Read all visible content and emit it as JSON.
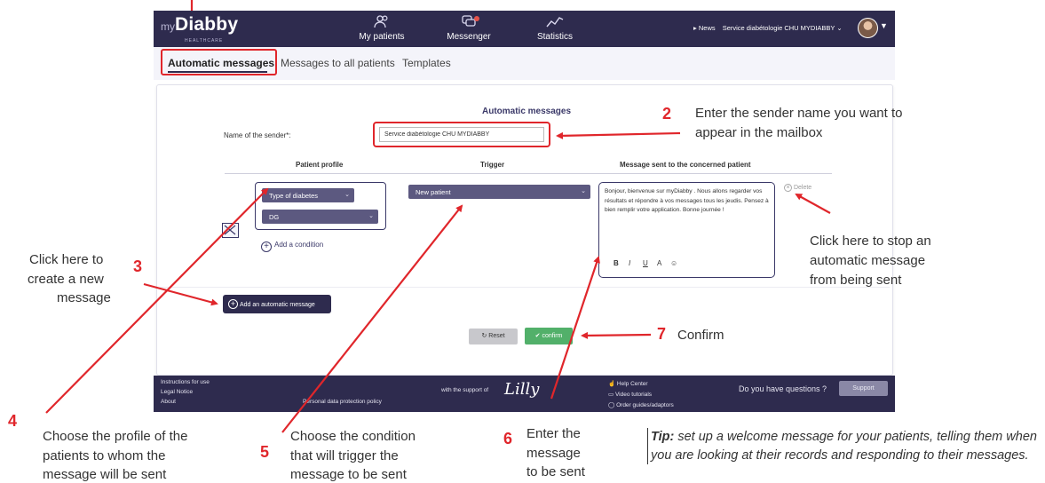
{
  "navbar": {
    "logo_prefix": "my",
    "logo_name": "Diabby",
    "logo_sub": "HEALTHCARE",
    "items": [
      {
        "label": "My patients",
        "icon": "people-icon"
      },
      {
        "label": "Messenger",
        "icon": "chat-icon"
      },
      {
        "label": "Statistics",
        "icon": "chart-icon"
      }
    ],
    "news_label": "News",
    "service_label": "Service diabétologie CHU MYDIABBY"
  },
  "tabs": [
    "Automatic messages",
    "Messages to all patients",
    "Templates"
  ],
  "form": {
    "title": "Automatic messages",
    "sender_label": "Name of the sender*:",
    "sender_value": "Service diabétologie CHU MYDIABBY",
    "columns": [
      "Patient profile",
      "Trigger",
      "Message sent to the concerned patient"
    ],
    "profile_select": "Type of diabetes",
    "profile_value": "DG",
    "add_condition": "Add a condition",
    "trigger_value": "New patient",
    "message": "Bonjour, bienvenue sur myDiabby . Nous allons regarder vos résultats et répondre à vos messages tous les jeudis. Pensez à bien remplir votre application. Bonne journée !",
    "format_buttons": [
      "B",
      "I",
      "U",
      "A",
      "☺"
    ],
    "delete_label": "Delete",
    "add_automatic_message": "Add an automatic message",
    "reset_label": "Reset",
    "confirm_label": "confirm"
  },
  "footer": {
    "left_links": [
      "Instructions for use",
      "Legal Notice",
      "About"
    ],
    "privacy": "Personal data protection policy",
    "support_of": "with the support of",
    "lilly": "Lilly",
    "help_links": [
      "Help Center",
      "Video tutorials",
      "Order guides/adaptors"
    ],
    "questions": "Do you have questions ?",
    "support_btn": "Support"
  },
  "annotations": {
    "n2": "2",
    "a2_line1": "Enter the sender name you want to",
    "a2_line2": "appear in the mailbox",
    "n3": "3",
    "a3_line1": "Click here to",
    "a3_line2": "create a new",
    "a3_line3": "message",
    "a_stop_line1": "Click here to stop an",
    "a_stop_line2": "automatic message",
    "a_stop_line3": "from being sent",
    "n7": "7",
    "a7": "Confirm",
    "n4": "4",
    "a4_line1": "Choose the profile of the",
    "a4_line2": "patients to whom the",
    "a4_line3": "message will be sent",
    "n5": "5",
    "a5_line1": "Choose the condition",
    "a5_line2": "that will trigger the",
    "a5_line3": "message to be sent",
    "n6": "6",
    "a6_line1": "Enter the",
    "a6_line2": "message",
    "a6_line3": "to be sent",
    "tip_label": "Tip:",
    "tip_text": "set up a welcome message for your patients, telling them when you are looking at their records and responding to their messages."
  },
  "colors": {
    "navy": "#2e2b4e",
    "accent_red": "#e0262b",
    "confirm_green": "#52b06a"
  }
}
